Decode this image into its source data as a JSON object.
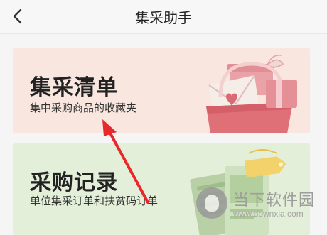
{
  "header": {
    "title": "集采助手",
    "back_icon": "chevron-left-icon"
  },
  "cards": [
    {
      "title": "集采清单",
      "subtitle": "集中采购商品的收藏夹",
      "background": "#f8e6df",
      "illustration": "gift-bag-icon"
    },
    {
      "title": "采购记录",
      "subtitle": "单位集采订单和扶贫码订单",
      "background": "#e3efd8",
      "illustration": "receipt-tag-icon"
    }
  ],
  "annotation": {
    "arrow_color": "#e8282b"
  },
  "watermark": {
    "text": "当下软件园",
    "url": "www.downxia.com"
  }
}
